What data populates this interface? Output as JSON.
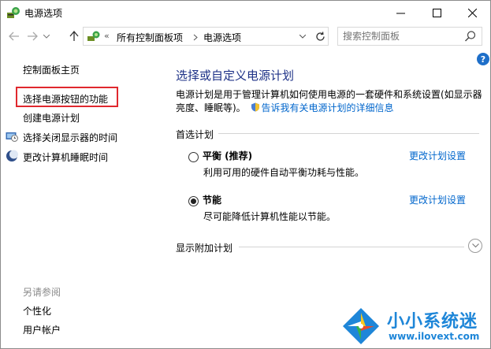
{
  "window": {
    "title": "电源选项"
  },
  "nav": {
    "address_prefix": "«",
    "breadcrumb": [
      "所有控制面板项",
      "电源选项"
    ],
    "search_placeholder": "搜索控制面板"
  },
  "sidebar": {
    "home": "控制面板主页",
    "items": [
      {
        "label": "选择电源按钮的功能",
        "highlighted": true
      },
      {
        "label": "创建电源计划"
      },
      {
        "label": "选择关闭显示器的时间",
        "icon": "monitor-clock-icon"
      },
      {
        "label": "更改计算机睡眠时间",
        "icon": "moon-icon"
      }
    ],
    "see_also_title": "另请参阅",
    "see_also": [
      "个性化",
      "用户帐户"
    ]
  },
  "main": {
    "heading": "选择或自定义电源计划",
    "description": "电源计划是用于管理计算机如何使用电源的一套硬件和系统设置(如显示器亮度、睡眠等)。",
    "description_link": "告诉我有关电源计划的详细信息",
    "preferred_section": "首选计划",
    "plans": [
      {
        "name": "平衡 (推荐)",
        "description": "利用可用的硬件自动平衡功耗与性能。",
        "change_label": "更改计划设置",
        "selected": false
      },
      {
        "name": "节能",
        "description": "尽可能降低计算机性能以节能。",
        "change_label": "更改计划设置",
        "selected": true
      }
    ],
    "additional_section": "显示附加计划"
  },
  "watermark": {
    "name": "小小系统迷",
    "url": "www.ilovext.com"
  },
  "colors": {
    "heading": "#1e3287",
    "link": "#0066cc",
    "highlight_border": "#e0282e",
    "watermark": "#1e86d8"
  }
}
